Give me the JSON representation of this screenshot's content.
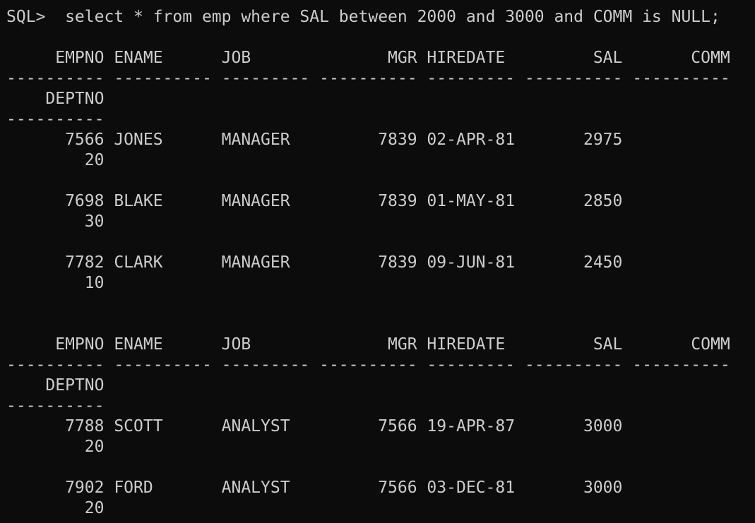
{
  "window": {
    "background": "#0c0c0c",
    "foreground": "#cccccc"
  },
  "terminal": {
    "lines": [
      "SQL>  select * from emp where SAL between 2000 and 3000 and COMM is NULL;",
      "",
      "     EMPNO ENAME      JOB              MGR HIREDATE         SAL       COMM",
      "---------- ---------- --------- ---------- --------- ---------- ----------",
      "    DEPTNO",
      "----------",
      "      7566 JONES      MANAGER         7839 02-APR-81       2975",
      "        20",
      "",
      "      7698 BLAKE      MANAGER         7839 01-MAY-81       2850",
      "        30",
      "",
      "      7782 CLARK      MANAGER         7839 09-JUN-81       2450",
      "        10",
      "",
      "",
      "     EMPNO ENAME      JOB              MGR HIREDATE         SAL       COMM",
      "---------- ---------- --------- ---------- --------- ---------- ----------",
      "    DEPTNO",
      "----------",
      "      7788 SCOTT      ANALYST         7566 19-APR-87       3000",
      "        20",
      "",
      "      7902 FORD       ANALYST         7566 03-DEC-81       3000",
      "        20"
    ]
  }
}
